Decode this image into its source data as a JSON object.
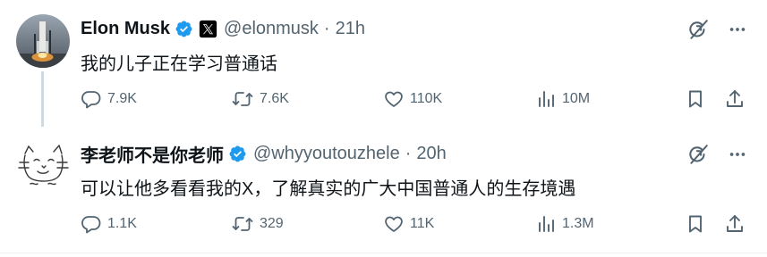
{
  "tweets": [
    {
      "author_name": "Elon Musk",
      "handle": "@elonmusk",
      "separator": "·",
      "time": "21h",
      "verified": true,
      "affiliate_badge": "x-logo",
      "text": "我的儿子正在学习普通话",
      "stats": {
        "replies": "7.9K",
        "retweets": "7.6K",
        "likes": "110K",
        "views": "10M"
      }
    },
    {
      "author_name": "李老师不是你老师",
      "handle": "@whyyoutouzhele",
      "separator": "·",
      "time": "20h",
      "verified": true,
      "text": "可以让他多看看我的X，了解真实的广大中国普通人的生存境遇",
      "stats": {
        "replies": "1.1K",
        "retweets": "329",
        "likes": "11K",
        "views": "1.3M"
      }
    }
  ],
  "icons": {
    "verified": "verified-badge-icon",
    "grok": "grok-icon",
    "more": "more-icon",
    "reply": "reply-icon",
    "retweet": "retweet-icon",
    "like": "heart-icon",
    "views": "views-icon",
    "bookmark": "bookmark-icon",
    "share": "share-icon"
  },
  "colors": {
    "verified": "#1d9bf0",
    "text_primary": "#0f1419",
    "text_secondary": "#536471",
    "thread_line": "#cfd9de"
  }
}
